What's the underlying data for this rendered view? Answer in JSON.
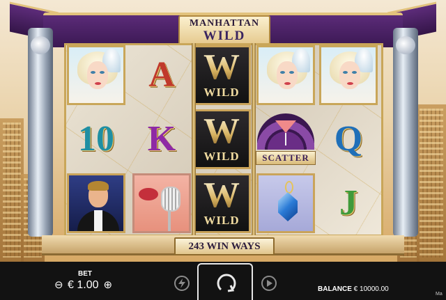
{
  "game": {
    "logo_line1": "MANHATTAN",
    "logo_line2": "WILD",
    "ways_label": "243 WIN WAYS"
  },
  "reels": [
    [
      "lady",
      "10",
      "man"
    ],
    [
      "A",
      "K",
      "mic"
    ],
    [
      "wild",
      "wild",
      "wild"
    ],
    [
      "lady",
      "scatter",
      "jewel"
    ],
    [
      "lady",
      "Q",
      "J"
    ]
  ],
  "symbols": {
    "A": {
      "text": "A",
      "color": "#c0392b"
    },
    "10": {
      "text": "10",
      "color": "#1f8fa3"
    },
    "K": {
      "text": "K",
      "color": "#8e2aa5"
    },
    "Q": {
      "text": "Q",
      "color": "#1f6fb8"
    },
    "J": {
      "text": "J",
      "color": "#3f9a3a"
    },
    "wild": {
      "letter": "W",
      "label": "WILD"
    },
    "scatter": {
      "label": "SCATTER"
    }
  },
  "controls": {
    "bet_label": "BET",
    "minus_icon": "⊖",
    "plus_icon": "⊕",
    "bet_value": "€ 1.00",
    "balance_label": "BALANCE",
    "balance_value": "€ 10000.00",
    "turbo_icon": "lightning-icon",
    "spin_icon": "spin-arrow-icon",
    "autoplay_icon": "play-icon",
    "menu_text": "Ma"
  }
}
